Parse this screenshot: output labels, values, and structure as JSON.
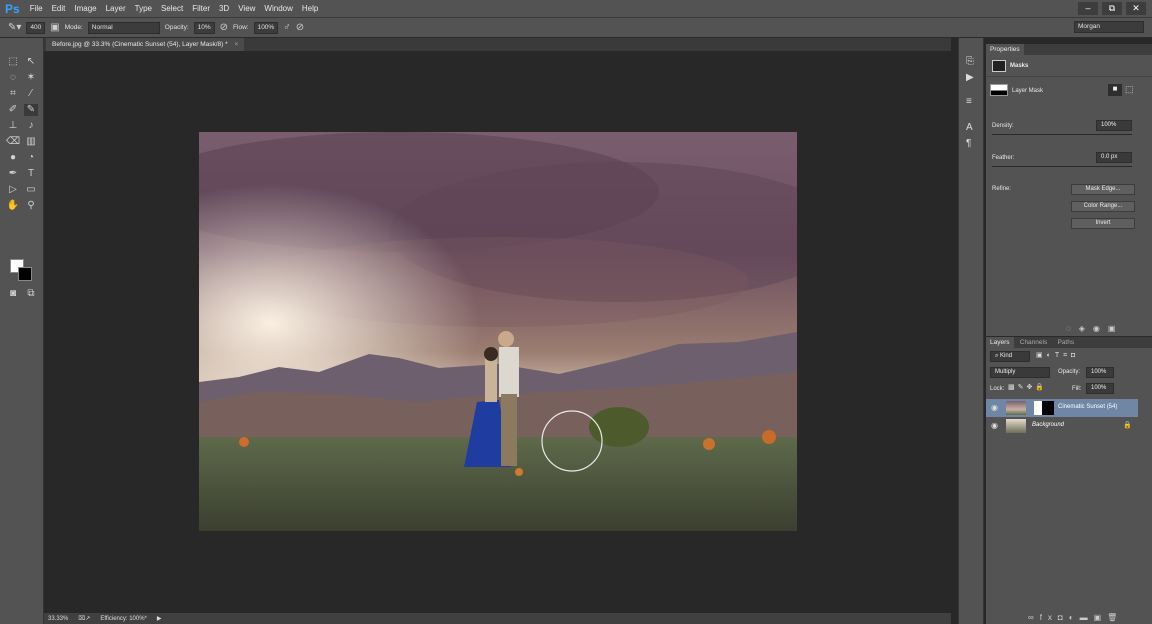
{
  "app": {
    "logo": "Ps"
  },
  "menu": [
    "File",
    "Edit",
    "Image",
    "Layer",
    "Type",
    "Select",
    "Filter",
    "3D",
    "View",
    "Window",
    "Help"
  ],
  "window_controls": [
    "–",
    "⧉",
    "✕"
  ],
  "options": {
    "brush_size": "400",
    "mode_label": "Mode:",
    "mode_value": "Normal",
    "opacity_label": "Opacity:",
    "opacity_value": "10%",
    "flow_label": "Flow:",
    "flow_value": "100%",
    "workspace": "Morgan"
  },
  "document": {
    "tab_title": "Before.jpg @ 33.3% (Cinematic Sunset (54), Layer Mask/8) *",
    "tab_close": "×"
  },
  "status": {
    "zoom": "33.33%",
    "efficiency": "Efficiency: 100%*",
    "arrow": "▶"
  },
  "properties": {
    "tab": "Properties",
    "section": "Masks",
    "mask_name": "Layer Mask",
    "density_label": "Density:",
    "density_value": "100%",
    "feather_label": "Feather:",
    "feather_value": "0.0 px",
    "refine_label": "Refine:",
    "buttons": [
      "Mask Edge...",
      "Color Range...",
      "Invert"
    ]
  },
  "layers_panel": {
    "tabs": [
      "Layers",
      "Channels",
      "Paths"
    ],
    "kind_label": "Kind",
    "blend_mode": "Multiply",
    "opacity_label": "Opacity:",
    "opacity_value": "100%",
    "lock_label": "Lock:",
    "fill_label": "Fill:",
    "fill_value": "100%",
    "layers": [
      {
        "name": "Cinematic Sunset (54)",
        "selected": true
      },
      {
        "name": "Background",
        "selected": false
      }
    ]
  },
  "colors": {
    "accent": "#3aa0ff",
    "panel": "#535353",
    "canvas_bg": "#282828",
    "selected_layer": "#6f87a5"
  }
}
